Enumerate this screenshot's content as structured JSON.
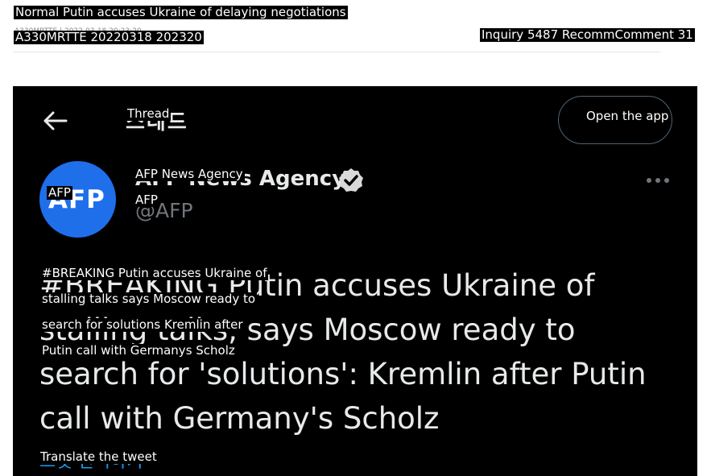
{
  "post": {
    "title": "Normal Putin accuses Ukraine of delaying negotiations",
    "meta_small": "A330MRTTE  |  2022-03-18 20:23:20",
    "id_line": "A330MRTTE 20220318 202320",
    "stats": "Inquiry 5487 RecommComment 31"
  },
  "tweet_screen": {
    "header": {
      "thread_label": "Thread",
      "thread_label_korean": "스레드",
      "open_app_label": "Open the app",
      "back_icon": "back-arrow-icon",
      "more_icon": "more-dots-icon"
    },
    "account": {
      "avatar_text": "AFP",
      "name": "AFP News Agency",
      "handle_label": "AFP",
      "handle_shown": "@AFP",
      "verified_icon": "verified-check-icon"
    },
    "tweet": {
      "shown_text": "#BREAKING Putin accuses Ukraine of stalling talks, says Moscow ready to search for 'solutions': Kremlin after Putin call with Germany's Scholz",
      "label_lines": [
        "#BREAKING Putin accuses Ukraine of",
        "stalling talks says Moscow ready to",
        "search for solutions Kremlin after",
        "Putin call with Germanys Scholz"
      ]
    },
    "translate_label": "Translate the tweet",
    "translate_label_korean": "트윗 번역하기"
  },
  "colors": {
    "screen_bg": "#000000",
    "avatar_bg": "#1f6feb",
    "text_primary": "#e7e9ea",
    "text_secondary": "#71767b",
    "link": "#1d9bf0"
  }
}
